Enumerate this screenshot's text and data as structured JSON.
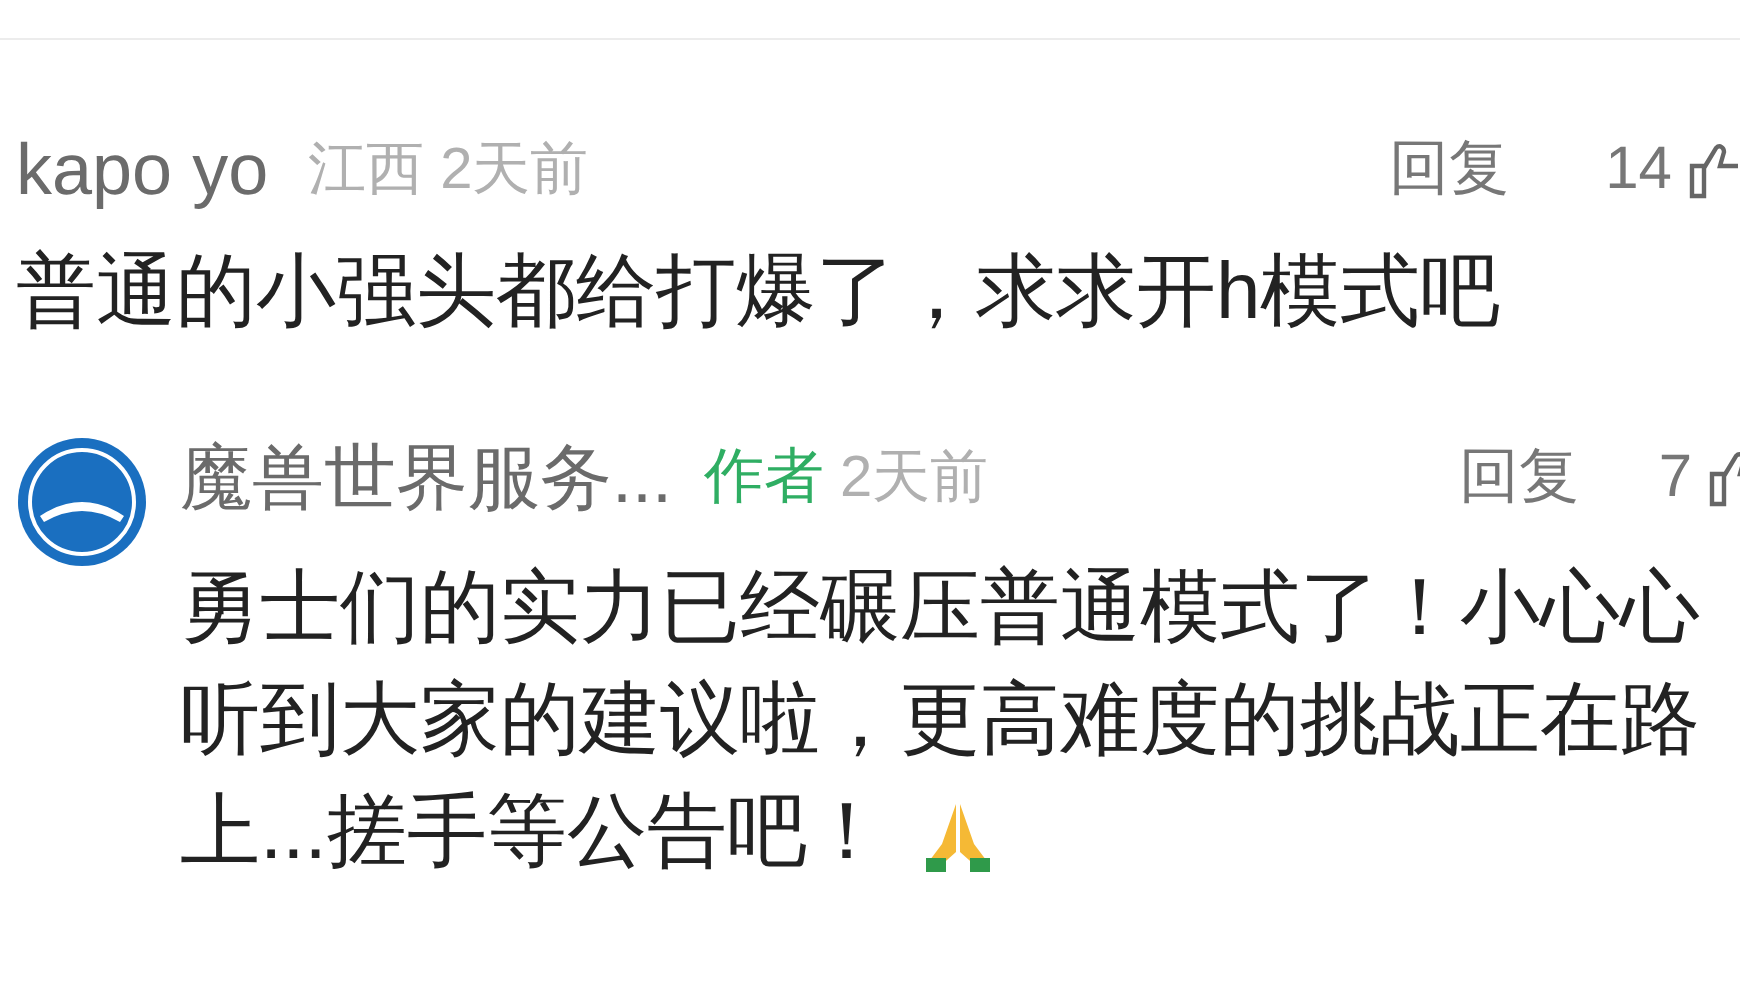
{
  "comments": [
    {
      "user": "kapo yo",
      "location": "江西",
      "time": "2天前",
      "reply": "回复",
      "likes": "14",
      "body": "普通的小强头都给打爆了，求求开h模式吧",
      "replies": [
        {
          "user": "魔兽世界服务...",
          "badge": "作者",
          "time": "2天前",
          "reply": "回复",
          "likes": "7",
          "body": "勇士们的实力已经碾压普通模式了！小心心听到大家的建议啦，更高难度的挑战正在路上...搓手等公告吧！"
        }
      ]
    }
  ]
}
